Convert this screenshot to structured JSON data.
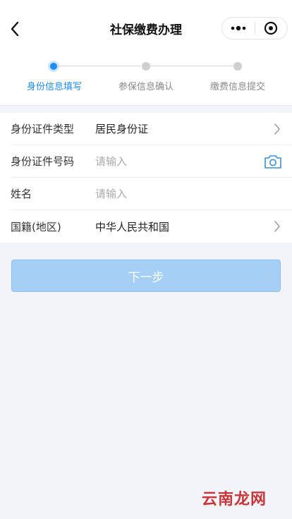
{
  "header": {
    "title": "社保缴费办理"
  },
  "steps": [
    {
      "label": "身份信息填写",
      "active": true
    },
    {
      "label": "参保信息确认",
      "active": false
    },
    {
      "label": "缴费信息提交",
      "active": false
    }
  ],
  "form": {
    "id_type": {
      "label": "身份证件类型",
      "value": "居民身份证"
    },
    "id_number": {
      "label": "身份证件号码",
      "placeholder": "请输入"
    },
    "name": {
      "label": "姓名",
      "placeholder": "请输入"
    },
    "nationality": {
      "label": "国籍(地区)",
      "value": "中华人民共和国"
    }
  },
  "next_button": {
    "label": "下一步"
  },
  "watermark": "云南龙网",
  "colors": {
    "accent": "#1d8cf8",
    "button_disabled": "#a6cff5",
    "watermark": "#c8353b"
  }
}
